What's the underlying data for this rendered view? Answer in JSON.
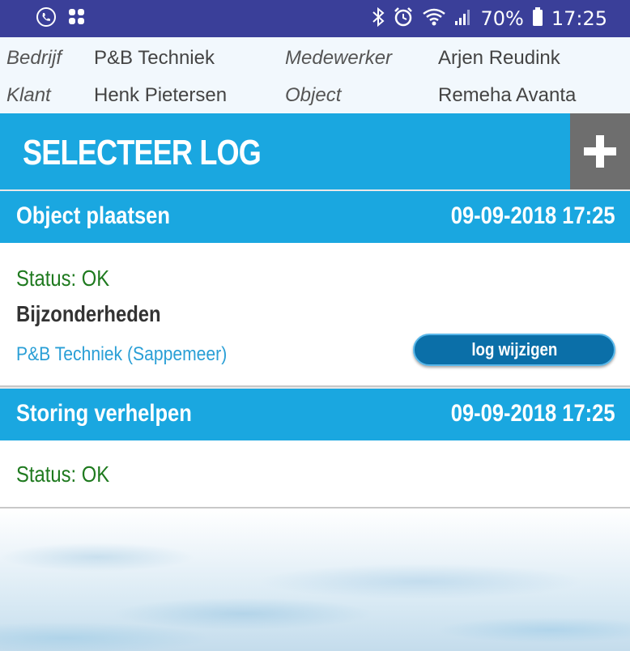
{
  "status_bar": {
    "battery": "70%",
    "time": "17:25",
    "icons": [
      "phone-call-icon",
      "app-grid-icon",
      "bluetooth-icon",
      "alarm-icon",
      "wifi-icon",
      "signal-icon",
      "battery-icon"
    ]
  },
  "info": {
    "bedrijf_label": "Bedrijf",
    "bedrijf_value": "P&B Techniek",
    "medewerker_label": "Medewerker",
    "medewerker_value": "Arjen Reudink",
    "klant_label": "Klant",
    "klant_value": "Henk Pietersen",
    "object_label": "Object",
    "object_value": "Remeha Avanta"
  },
  "header": {
    "title": "SELECTEER LOG",
    "add_icon": "plus-icon"
  },
  "logs": [
    {
      "name": "Object plaatsen",
      "datetime": "09-09-2018 17:25",
      "status": "Status: OK",
      "details_label": "Bijzonderheden",
      "company": "P&B Techniek (Sappemeer)",
      "edit_label": "log wijzigen"
    },
    {
      "name": "Storing verhelpen",
      "datetime": "09-09-2018 17:25",
      "status": "Status: OK"
    }
  ],
  "colors": {
    "status_bar": "#3a3f99",
    "header_blue": "#1aa7e0",
    "add_button": "#6e6e6e",
    "status_green": "#1f7a1f",
    "link_blue": "#2a9fd6",
    "button_blue": "#0b6fa8"
  }
}
